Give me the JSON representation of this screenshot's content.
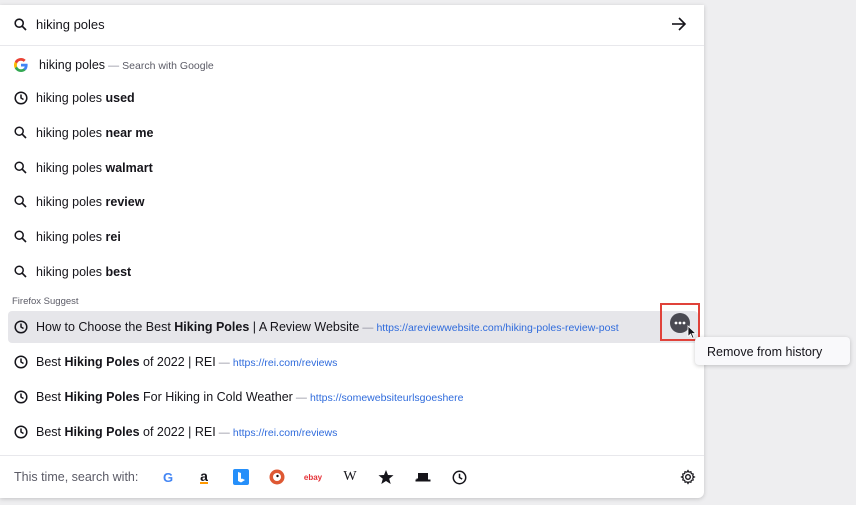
{
  "search": {
    "query": "hiking poles"
  },
  "google_row": {
    "query": "hiking poles",
    "separator": " — ",
    "hint": "Search with Google"
  },
  "suggestions": [
    {
      "type": "history",
      "prefix": "hiking poles ",
      "bold": "used"
    },
    {
      "type": "search",
      "prefix": "hiking poles ",
      "bold": "near me"
    },
    {
      "type": "search",
      "prefix": "hiking poles ",
      "bold": "walmart"
    },
    {
      "type": "search",
      "prefix": "hiking poles ",
      "bold": "review"
    },
    {
      "type": "search",
      "prefix": "hiking poles ",
      "bold": "rei"
    },
    {
      "type": "search",
      "prefix": "hiking poles ",
      "bold": "best"
    }
  ],
  "section_header": "Firefox Suggest",
  "history_results": [
    {
      "pre": "How to Choose the Best ",
      "bold": "Hiking Poles",
      "post": " | A Review Website",
      "sep": " — ",
      "url": "https://areviewwebsite.com/hiking-poles-review-post"
    },
    {
      "pre": "Best ",
      "bold": "Hiking Poles",
      "post": " of 2022 | REI",
      "sep": " — ",
      "url": "https://rei.com/reviews"
    },
    {
      "pre": "Best ",
      "bold": "Hiking Poles",
      "post": " For Hiking in Cold Weather",
      "sep": " — ",
      "url": "https://somewebsiteurlsgoeshere"
    },
    {
      "pre": "Best ",
      "bold": "Hiking Poles",
      "post": " of 2022 | REI",
      "sep": " — ",
      "url": "https://rei.com/reviews"
    }
  ],
  "context_menu": {
    "remove_label": "Remove from history"
  },
  "footer": {
    "label": "This time, search with:",
    "engines": [
      "google-icon",
      "amazon-icon",
      "bing-icon",
      "duckduckgo-icon",
      "ebay-icon",
      "wikipedia-icon",
      "bookmarks-star-icon",
      "tabs-icon",
      "history-icon"
    ],
    "wiki_glyph": "W",
    "ebay_text": "ebay",
    "amazon_glyph": "a",
    "google_glyph": "G"
  },
  "colors": {
    "accent_url": "#2f6bdc",
    "highlight": "#e6e6ea",
    "focus_outline": "#e0423a"
  }
}
